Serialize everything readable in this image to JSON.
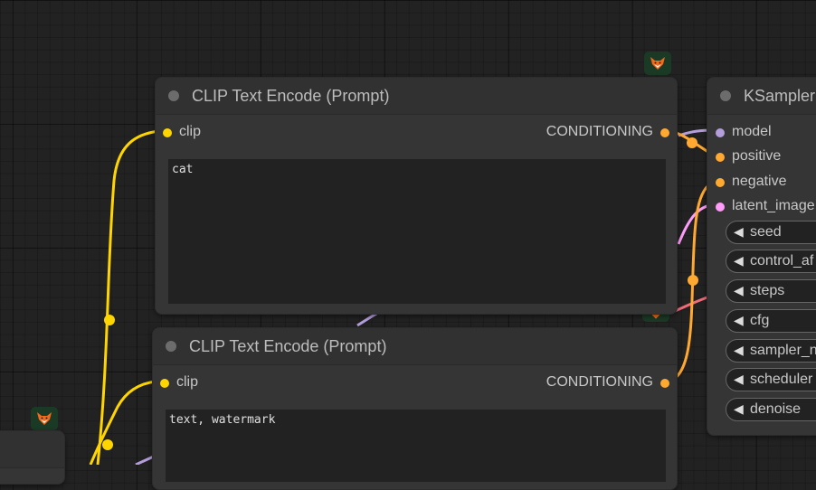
{
  "colors": {
    "clip": "#ffd500",
    "conditioning": "#ffa931",
    "model": "#b39ddb",
    "latent": "#ff9cf9",
    "badge_bg": "#1b3a25"
  },
  "nodes": {
    "clip_pos": {
      "title": "CLIP Text Encode (Prompt)",
      "input_label": "clip",
      "output_label": "CONDITIONING",
      "text": "cat"
    },
    "clip_neg": {
      "title": "CLIP Text Encode (Prompt)",
      "input_label": "clip",
      "output_label": "CONDITIONING",
      "text": "text, watermark"
    },
    "ksampler": {
      "title": "KSampler",
      "inputs": [
        "model",
        "positive",
        "negative",
        "latent_image"
      ],
      "widgets": [
        "seed",
        "control_af",
        "steps",
        "cfg",
        "sampler_n",
        "scheduler",
        "denoise"
      ]
    }
  },
  "badge_icon": "fox-icon"
}
